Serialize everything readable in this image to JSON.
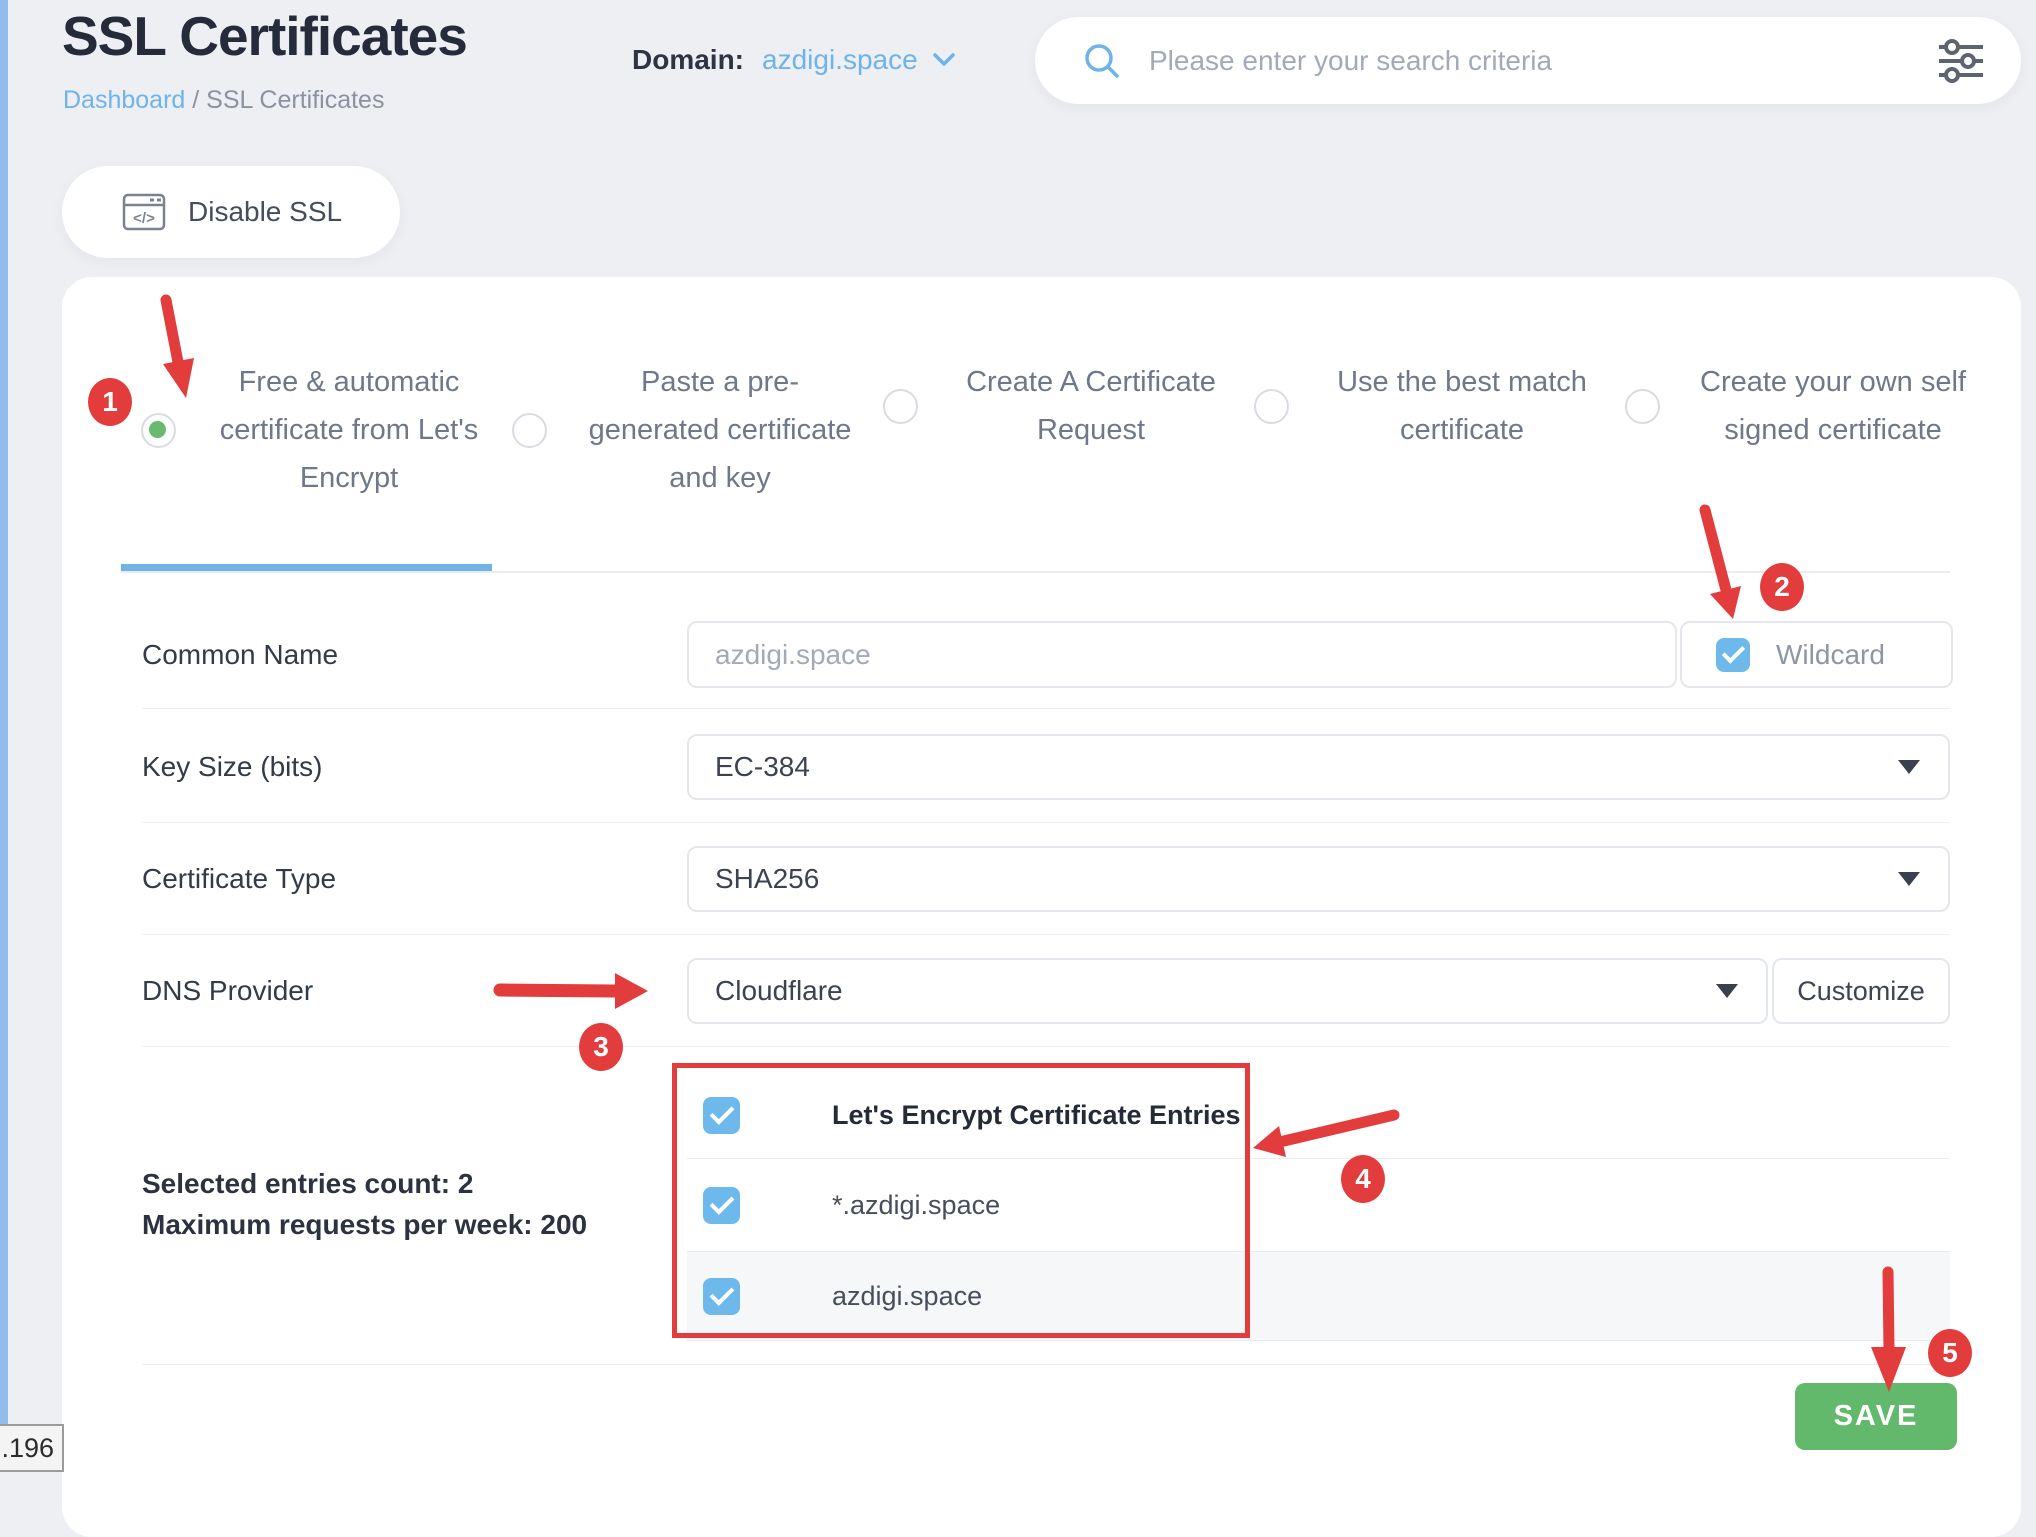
{
  "header": {
    "title": "SSL Certificates",
    "breadcrumb": {
      "home": "Dashboard",
      "separator": " / ",
      "current": "SSL Certificates"
    },
    "domain_label": "Domain:",
    "domain_value": "azdigi.space",
    "search_placeholder": "Please enter your search criteria"
  },
  "toolbar": {
    "disable_ssl_label": "Disable SSL"
  },
  "tabs": [
    {
      "label": "Free & automatic certificate from Let's Encrypt",
      "selected": true
    },
    {
      "label": "Paste a pre-generated certificate and key",
      "selected": false
    },
    {
      "label": "Create A Certificate Request",
      "selected": false
    },
    {
      "label": "Use the best match certificate",
      "selected": false
    },
    {
      "label": "Create your own self signed certificate",
      "selected": false
    }
  ],
  "form": {
    "common_name": {
      "label": "Common Name",
      "value": "azdigi.space",
      "wildcard_label": "Wildcard",
      "wildcard_checked": true
    },
    "key_size": {
      "label": "Key Size (bits)",
      "value": "EC-384"
    },
    "certificate_type": {
      "label": "Certificate Type",
      "value": "SHA256"
    },
    "dns_provider": {
      "label": "DNS Provider",
      "value": "Cloudflare",
      "customize_label": "Customize"
    },
    "entries": {
      "summary_line1": "Selected entries count: 2",
      "summary_line2": "Maximum requests per week: 200",
      "header": "Let's Encrypt Certificate Entries",
      "rows": [
        "*.azdigi.space",
        "azdigi.space"
      ],
      "all_checked": true
    },
    "save_label": "SAVE"
  },
  "annotations": {
    "badges": [
      "1",
      "2",
      "3",
      "4",
      "5"
    ]
  },
  "status_fragment": ".196",
  "colors": {
    "accent_blue": "#6eb3e9",
    "checkbox_blue": "#6eb9ec",
    "save_green": "#63b96b",
    "radio_green": "#68ba70",
    "annotation_red": "#e23c3c"
  }
}
